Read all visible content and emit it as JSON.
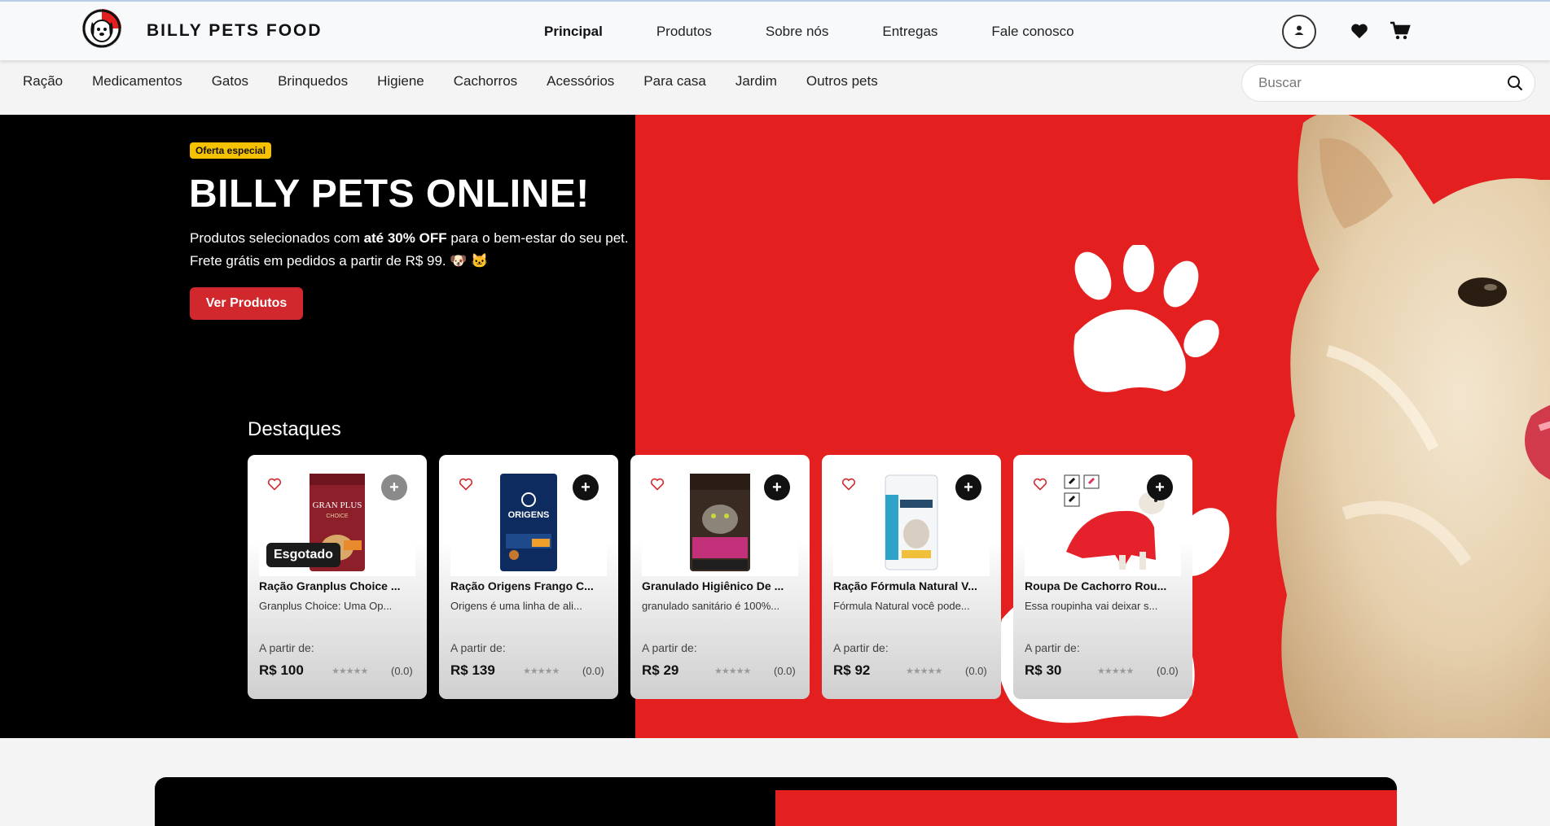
{
  "brand": {
    "name": "BILLY PETS FOOD",
    "accent": "#e3201f"
  },
  "mainnav": [
    "Principal",
    "Produtos",
    "Sobre nós",
    "Entregas",
    "Fale conosco"
  ],
  "mainnav_active": "Principal",
  "header_icons": [
    "user-icon",
    "heart-icon",
    "cart-icon"
  ],
  "categories": [
    "Ração",
    "Medicamentos",
    "Gatos",
    "Brinquedos",
    "Higiene",
    "Cachorros",
    "Acessórios",
    "Para casa",
    "Jardim",
    "Outros pets"
  ],
  "search": {
    "placeholder": "Buscar",
    "value": ""
  },
  "hero": {
    "badge": "Oferta especial",
    "title": "BILLY PETS ONLINE!",
    "sub1_pre": "Produtos selecionados com ",
    "sub1_bold": "até 30% OFF",
    "sub1_post": " para o bem-estar do seu pet.",
    "sub2": "Frete grátis em pedidos a partir de R$ 99. 🐶 🐱",
    "cta": "Ver Produtos"
  },
  "section_title": "Destaques",
  "products": [
    {
      "name": "Ração Granplus Choice ...",
      "desc": "Granplus Choice: Uma Op...",
      "from": "A partir de:",
      "price": "R$ 100",
      "rating": "(0.0)",
      "sold_out": "Esgotado",
      "stars": "★★★★★"
    },
    {
      "name": "Ração Origens Frango C...",
      "desc": "Origens é uma linha de ali...",
      "from": "A partir de:",
      "price": "R$ 139",
      "rating": "(0.0)",
      "sold_out": "",
      "stars": "★★★★★"
    },
    {
      "name": "Granulado Higiênico De ...",
      "desc": "granulado sanitário é 100%...",
      "from": "A partir de:",
      "price": "R$ 29",
      "rating": "(0.0)",
      "sold_out": "",
      "stars": "★★★★★"
    },
    {
      "name": "Ração Fórmula Natural V...",
      "desc": "Fórmula Natural você pode...",
      "from": "A partir de:",
      "price": "R$ 92",
      "rating": "(0.0)",
      "sold_out": "",
      "stars": "★★★★★"
    },
    {
      "name": "Roupa De Cachorro Rou...",
      "desc": "Essa roupinha vai deixar s...",
      "from": "A partir de:",
      "price": "R$ 30",
      "rating": "(0.0)",
      "sold_out": "",
      "stars": "★★★★★"
    }
  ],
  "package_labels": {
    "granplus": "GRAN PLUS",
    "granplus_sub": "CHOICE",
    "origens": "ORIGENS"
  }
}
